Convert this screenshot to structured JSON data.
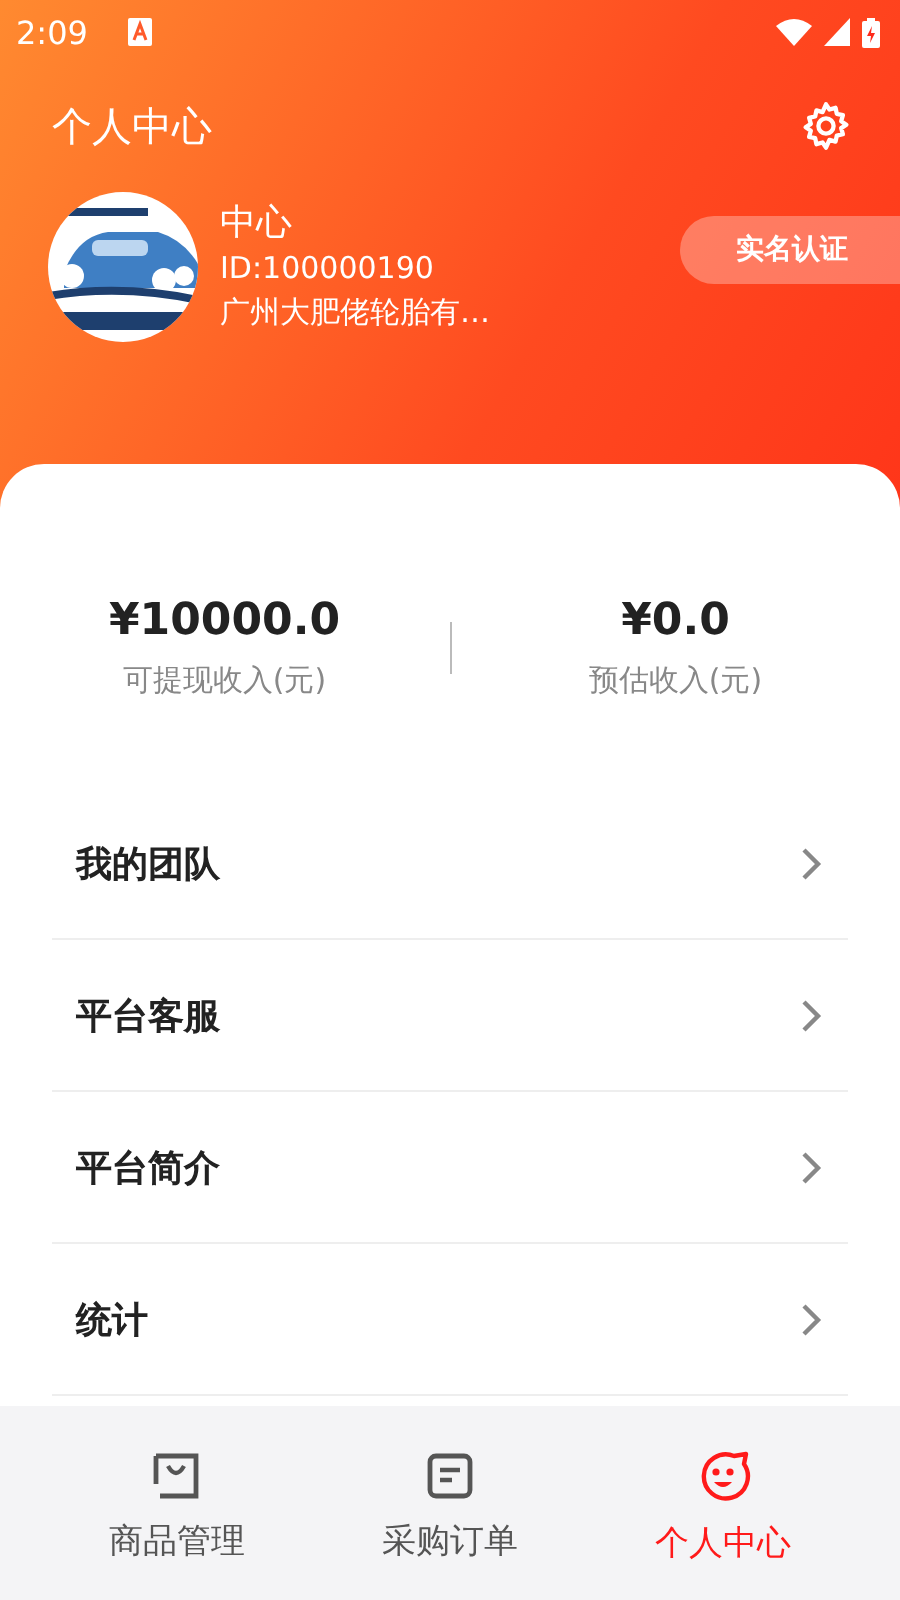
{
  "status_bar": {
    "time": "2:09"
  },
  "header": {
    "title": "个人中心"
  },
  "profile": {
    "name": "中心",
    "id": "ID:100000190",
    "company": "广州大肥佬轮胎有…",
    "verify_button": "实名认证"
  },
  "stats": [
    {
      "value": "¥10000.0",
      "label": "可提现收入(元)"
    },
    {
      "value": "¥0.0",
      "label": "预估收入(元)"
    }
  ],
  "menu": [
    {
      "label": "我的团队"
    },
    {
      "label": "平台客服"
    },
    {
      "label": "平台简介"
    },
    {
      "label": "统计"
    }
  ],
  "tabs": [
    {
      "label": "商品管理",
      "kind": "bag",
      "selected": false
    },
    {
      "label": "采购订单",
      "kind": "order",
      "selected": false
    },
    {
      "label": "个人中心",
      "kind": "face",
      "selected": true
    }
  ]
}
